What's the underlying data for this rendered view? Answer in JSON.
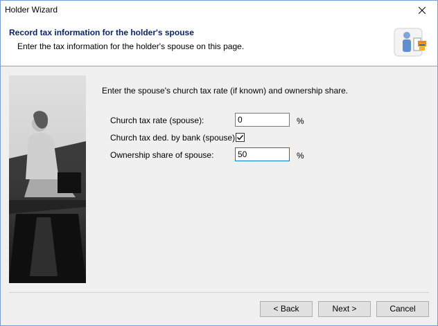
{
  "window": {
    "title": "Holder Wizard"
  },
  "header": {
    "title": "Record tax information for the holder's spouse",
    "subtitle": "Enter the tax information for the holder's spouse on this page."
  },
  "main": {
    "instruction": "Enter the spouse's church tax rate (if known) and ownership share.",
    "church_tax_rate": {
      "label": "Church tax rate (spouse):",
      "value": "0",
      "unit": "%"
    },
    "church_tax_ded": {
      "label": "Church tax ded. by bank (spouse):",
      "checked": true
    },
    "ownership_share": {
      "label": "Ownership share of spouse:",
      "value": "50",
      "unit": "%"
    }
  },
  "buttons": {
    "back": "< Back",
    "next": "Next >",
    "cancel": "Cancel"
  },
  "colors": {
    "header_title": "#0a246a",
    "focus_border": "#0078d7"
  }
}
